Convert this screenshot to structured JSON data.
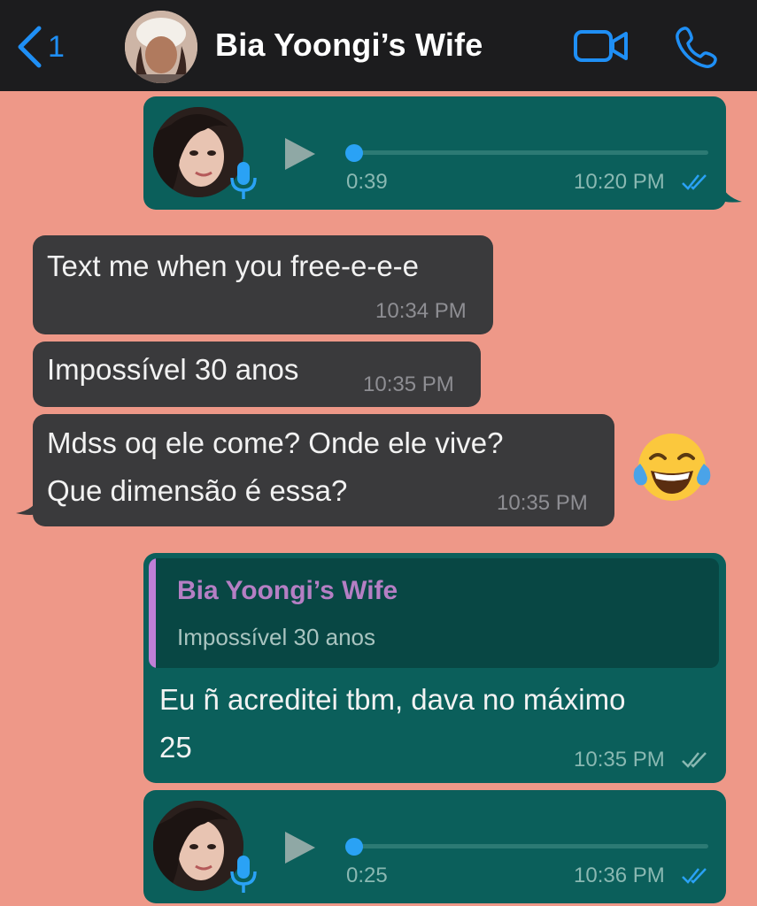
{
  "header": {
    "back_count": "1",
    "contact_name": "Bia Yoongi’s Wife",
    "icons": [
      "chevron-left-icon",
      "video-call-icon",
      "phone-call-icon"
    ],
    "accent_color": "#1f8ff5"
  },
  "messages": [
    {
      "type": "voice",
      "direction": "outgoing",
      "duration": "0:39",
      "time": "10:20 PM",
      "status": "read",
      "progress": 0
    },
    {
      "type": "text",
      "direction": "incoming",
      "text": "Text me when you free-e-e-e",
      "time": "10:34 PM"
    },
    {
      "type": "text",
      "direction": "incoming",
      "text": "Impossível 30 anos",
      "time": "10:35 PM"
    },
    {
      "type": "text",
      "direction": "incoming",
      "lines": [
        "Mdss oq ele come? Onde ele vive?",
        "Que dimensão é essa?"
      ],
      "time": "10:35 PM",
      "reaction": "😂"
    },
    {
      "type": "reply",
      "direction": "outgoing",
      "quote": {
        "author": "Bia Yoongi’s Wife",
        "text": "Impossível 30 anos"
      },
      "lines": [
        "Eu ñ acreditei tbm, dava no máximo",
        "25"
      ],
      "time": "10:35 PM",
      "status": "delivered"
    },
    {
      "type": "voice",
      "direction": "outgoing",
      "duration": "0:25",
      "time": "10:36 PM",
      "status": "read",
      "progress": 0
    }
  ],
  "colors": {
    "chat_background": "#EE9888",
    "outgoing_bubble": "#0b5f5b",
    "incoming_bubble": "#3a3a3c",
    "quote_accent": "#c07fd6"
  }
}
